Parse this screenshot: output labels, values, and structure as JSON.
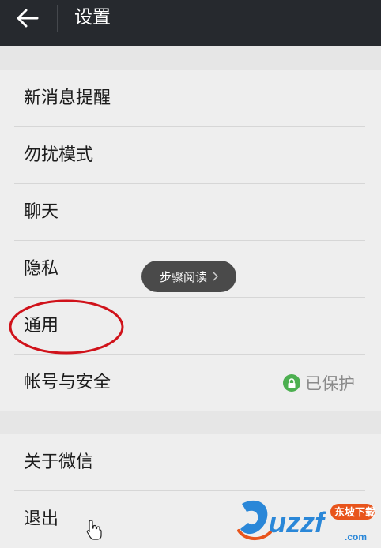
{
  "header": {
    "title": "设置",
    "back_icon": "arrow-left-icon"
  },
  "settings": {
    "group1": [
      {
        "label": "新消息提醒"
      },
      {
        "label": "勿扰模式"
      },
      {
        "label": "聊天"
      },
      {
        "label": "隐私"
      },
      {
        "label": "通用"
      },
      {
        "label": "帐号与安全",
        "status": "已保护",
        "status_icon": "lock-icon"
      }
    ],
    "group2": [
      {
        "label": "关于微信"
      },
      {
        "label": "退出"
      }
    ]
  },
  "tooltip": {
    "label": "步骤阅读",
    "icon": "chevron-right-icon"
  },
  "watermark": {
    "text": "uzzf",
    "suffix": ".com",
    "tagline": "东坡下载"
  },
  "colors": {
    "header_bg": "#26292e",
    "page_bg": "#e6e6e6",
    "item_bg": "#eeeeee",
    "annotation": "#d0121a",
    "protected_green": "#4caf50"
  }
}
